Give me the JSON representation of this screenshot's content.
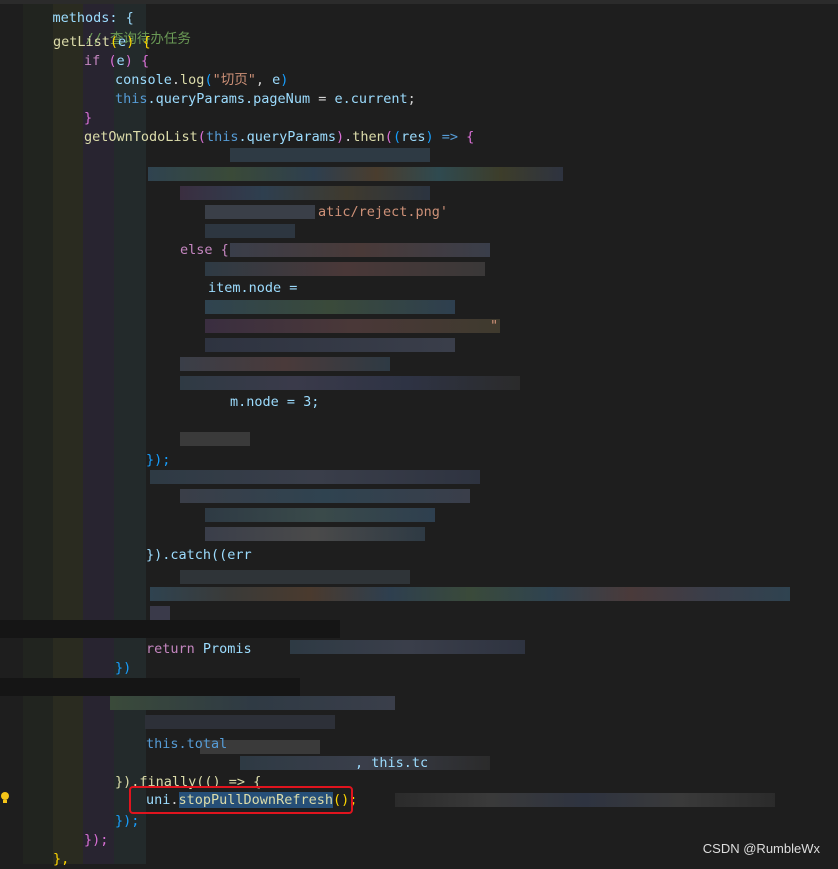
{
  "code": {
    "l0": "methods: {",
    "l1_comment": "// 查询待办任务",
    "l2_fn": "getList",
    "l2_param": "e",
    "l3_if": "if",
    "l3_param": "e",
    "l4_obj": "console",
    "l4_fn": "log",
    "l4_str": "\"切页\"",
    "l4_arg": "e",
    "l5_this": "this",
    "l5_prop": ".queryParams.pageNum",
    "l5_rhs": "e.current",
    "l7_fn": "getOwnTodoList",
    "l7_this": "this",
    "l7_prop": ".queryParams",
    "l7_then": "then",
    "l7_res": "res",
    "frag_reject": "atic/reject.png'",
    "frag_else": "else {",
    "frag_node": "item.node =",
    "frag_quote": "\"",
    "frag_node3": "m.node = 3;",
    "frag_close": "});",
    "frag_catch": "}).catch((err",
    "frag_return": "return",
    "frag_promise": "Promis",
    "frag_brace": "})",
    "frag_this_total": "this.total",
    "frag_tc": ", this.tc",
    "frag_finally": "}).finally(() => {",
    "l_uni": "uni",
    "l_stop": "stopPullDownRefresh",
    "l_stop_tail": "();",
    "l_close1": "});",
    "l_close2": "});",
    "l_close3": "},"
  },
  "watermark": "CSDN @RumbleWx",
  "colors": {
    "highlight_border": "#e0141e",
    "selection": "#264f78",
    "lightbulb": "#f5c518"
  },
  "icons": {
    "lightbulb": "lightbulb-icon"
  }
}
